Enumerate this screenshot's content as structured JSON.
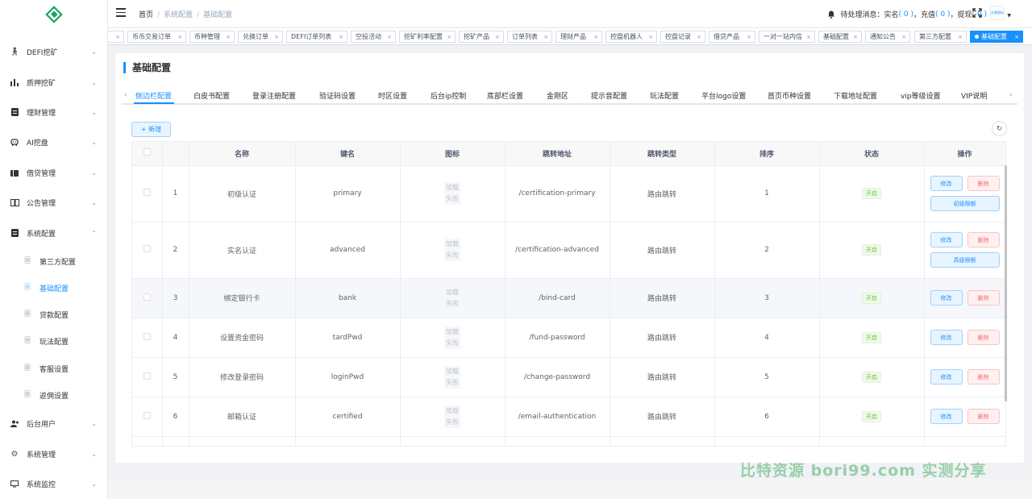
{
  "sidebar": {
    "menus": [
      {
        "label": "DEFI挖矿",
        "icon": "person-icon"
      },
      {
        "label": "质押挖矿",
        "icon": "bar-chart-icon"
      },
      {
        "label": "理财管理",
        "icon": "document-icon"
      },
      {
        "label": "AI挖盘",
        "icon": "robot-icon"
      },
      {
        "label": "借贷管理",
        "icon": "wallet-icon"
      },
      {
        "label": "公告管理",
        "icon": "book-icon"
      },
      {
        "label": "系统配置",
        "icon": "document-icon"
      }
    ],
    "sub_items": [
      {
        "label": "第三方配置"
      },
      {
        "label": "基础配置",
        "active": true
      },
      {
        "label": "贷款配置"
      },
      {
        "label": "玩法配置"
      },
      {
        "label": "客服设置"
      },
      {
        "label": "返佣设置"
      }
    ],
    "bottom_menus": [
      {
        "label": "后台用户",
        "icon": "users-icon"
      },
      {
        "label": "系统管理",
        "icon": "gear-icon"
      },
      {
        "label": "系统监控",
        "icon": "monitor-icon"
      }
    ]
  },
  "header": {
    "breadcrumb": [
      "首页",
      "系统配置",
      "基础配置"
    ],
    "notice_label": "待处理消息：实名",
    "notice_realname_count": "( 0 )",
    "notice_recharge_label": "，充值",
    "notice_recharge_count": "( 0 )",
    "notice_withdraw_label": "，提现",
    "notice_withdraw_count": "( 0 )",
    "avatar_text": "头像图标"
  },
  "tags": [
    {
      "label": ""
    },
    {
      "label": "币币交易订单"
    },
    {
      "label": "币种管理"
    },
    {
      "label": "兑换订单"
    },
    {
      "label": "DEFI订单列表"
    },
    {
      "label": "空投活动"
    },
    {
      "label": "挖矿利率配置"
    },
    {
      "label": "挖矿产品"
    },
    {
      "label": "订单列表"
    },
    {
      "label": "理财产品"
    },
    {
      "label": "控盘机器人"
    },
    {
      "label": "控盘记录"
    },
    {
      "label": "借贷产品"
    },
    {
      "label": "一对一站内信"
    },
    {
      "label": "基础配置"
    },
    {
      "label": "通知公告"
    },
    {
      "label": "第三方配置"
    },
    {
      "label": "基础配置",
      "active": true
    }
  ],
  "page": {
    "title": "基础配置",
    "add_label": "+ 新增",
    "refresh_icon": "refresh-icon"
  },
  "tabs": [
    {
      "label": "侧边栏配置",
      "active": true
    },
    {
      "label": "白皮书配置"
    },
    {
      "label": "登录注册配置"
    },
    {
      "label": "验证码设置"
    },
    {
      "label": "时区设置"
    },
    {
      "label": "后台ip控制"
    },
    {
      "label": "底部栏设置"
    },
    {
      "label": "金刚区"
    },
    {
      "label": "提示音配置"
    },
    {
      "label": "玩法配置"
    },
    {
      "label": "平台logo设置"
    },
    {
      "label": "首页币种设置"
    },
    {
      "label": "下载地址配置"
    },
    {
      "label": "vip等级设置"
    },
    {
      "label": "VIP说明"
    }
  ],
  "table": {
    "columns": [
      "",
      "",
      "名称",
      "键名",
      "图标",
      "跳转地址",
      "跳转类型",
      "排序",
      "状态",
      "操作"
    ],
    "img_fail_text": "加载失败",
    "edit_label": "修改",
    "delete_label": "删除",
    "rows": [
      {
        "index": "1",
        "name": "初级认证",
        "key": "primary",
        "url": "/certification-primary",
        "type": "路由跳转",
        "sort": "1",
        "status": "开启",
        "extra": "初级限额"
      },
      {
        "index": "2",
        "name": "实名认证",
        "key": "advanced",
        "url": "/certification-advanced",
        "type": "路由跳转",
        "sort": "2",
        "status": "开启",
        "extra": "高级限额"
      },
      {
        "index": "3",
        "name": "绑定银行卡",
        "key": "bank",
        "url": "/bind-card",
        "type": "路由跳转",
        "sort": "3",
        "status": "开启",
        "extra": ""
      },
      {
        "index": "4",
        "name": "设置资金密码",
        "key": "tardPwd",
        "url": "/fund-password",
        "type": "路由跳转",
        "sort": "4",
        "status": "开启",
        "extra": ""
      },
      {
        "index": "5",
        "name": "修改登录密码",
        "key": "loginPwd",
        "url": "/change-password",
        "type": "路由跳转",
        "sort": "5",
        "status": "开启",
        "extra": ""
      },
      {
        "index": "6",
        "name": "邮箱认证",
        "key": "certified",
        "url": "/email-authentication",
        "type": "路由跳转",
        "sort": "6",
        "status": "开启",
        "extra": ""
      }
    ]
  },
  "watermark": "比特资源 bori99.com 实测分享",
  "colors": {
    "accent": "#1890ff",
    "success": "#67c23a",
    "danger": "#f56c6c",
    "logo": "#1aa760"
  }
}
